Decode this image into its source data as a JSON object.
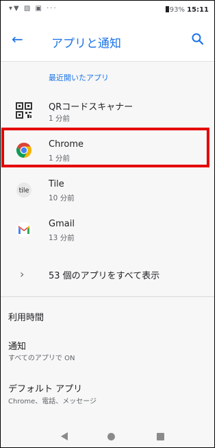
{
  "status_bar": {
    "left_icons": "▾▼ ▧ ▣ ···",
    "battery_text": "93%",
    "time": "15:11"
  },
  "header": {
    "title": "アプリと通知"
  },
  "recent_apps": {
    "label": "最近開いたアプリ",
    "items": [
      {
        "name": "QRコードスキャナー",
        "time": "1 分前"
      },
      {
        "name": "Chrome",
        "time": "1 分前"
      },
      {
        "name": "Tile",
        "time": "10 分前"
      },
      {
        "name": "Gmail",
        "time": "13 分前"
      }
    ],
    "see_all": "53 個のアプリをすべて表示"
  },
  "settings": [
    {
      "title": "利用時間",
      "subtitle": ""
    },
    {
      "title": "通知",
      "subtitle": "すべてのアプリで ON"
    },
    {
      "title": "デフォルト アプリ",
      "subtitle": "Chrome、電話、メッセージ"
    }
  ],
  "colors": {
    "accent": "#1a73e8",
    "highlight": "#e60000"
  }
}
